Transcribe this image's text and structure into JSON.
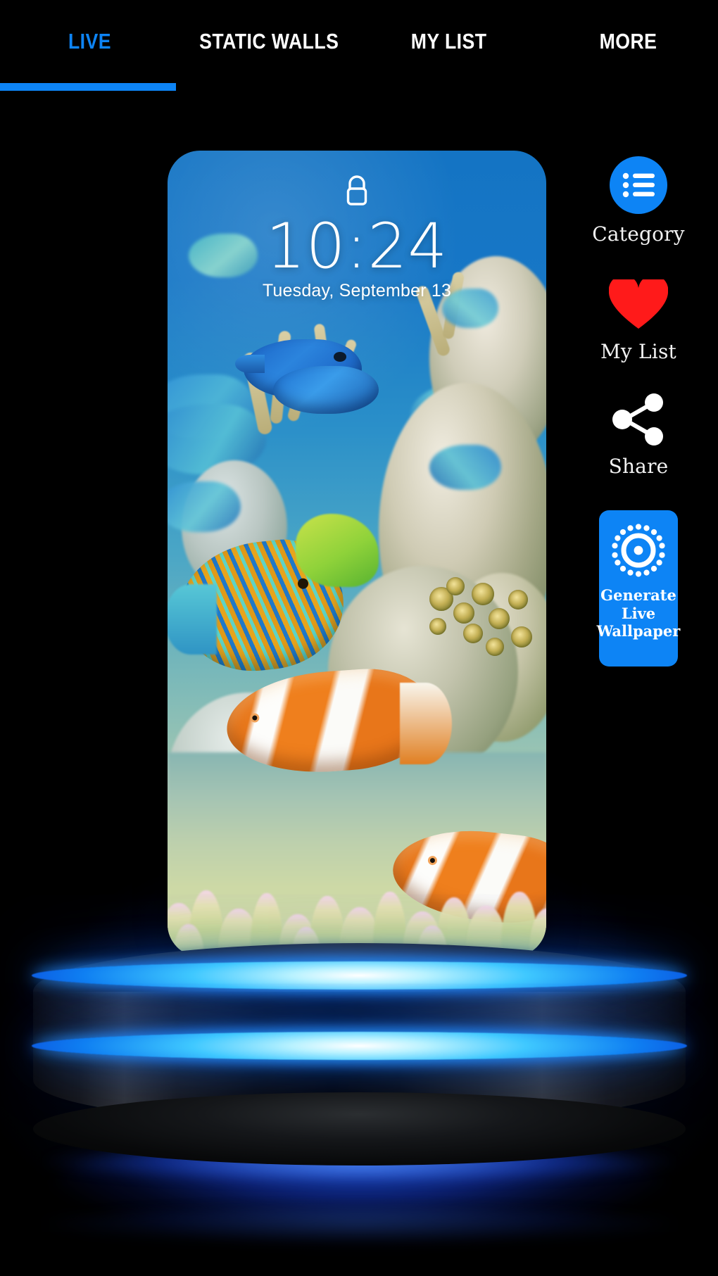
{
  "app": {
    "background_color": "#000000",
    "accent_color": "#0d84f5",
    "heart_color": "#ff1a1a"
  },
  "tabs": [
    {
      "id": "live",
      "label": "LIVE",
      "active": true
    },
    {
      "id": "static-walls",
      "label": "STATIC WALLS",
      "active": false
    },
    {
      "id": "my-list",
      "label": "MY LIST",
      "active": false
    },
    {
      "id": "more",
      "label": "MORE",
      "active": false
    }
  ],
  "preview": {
    "wallpaper_name": "aquarium-coral-reef-clownfish",
    "lockscreen": {
      "lock_icon": "lock-icon",
      "time": "10:24",
      "date": "Tuesday, September 13"
    }
  },
  "rail": [
    {
      "id": "category",
      "label": "Category",
      "icon": "list-bullets-icon"
    },
    {
      "id": "my-list",
      "label": "My List",
      "icon": "heart-icon"
    },
    {
      "id": "share",
      "label": "Share",
      "icon": "share-nodes-icon"
    }
  ],
  "generate_button": {
    "icon": "radial-target-icon",
    "line1": "Generate",
    "line2": "Live",
    "line3": "Wallpaper"
  }
}
